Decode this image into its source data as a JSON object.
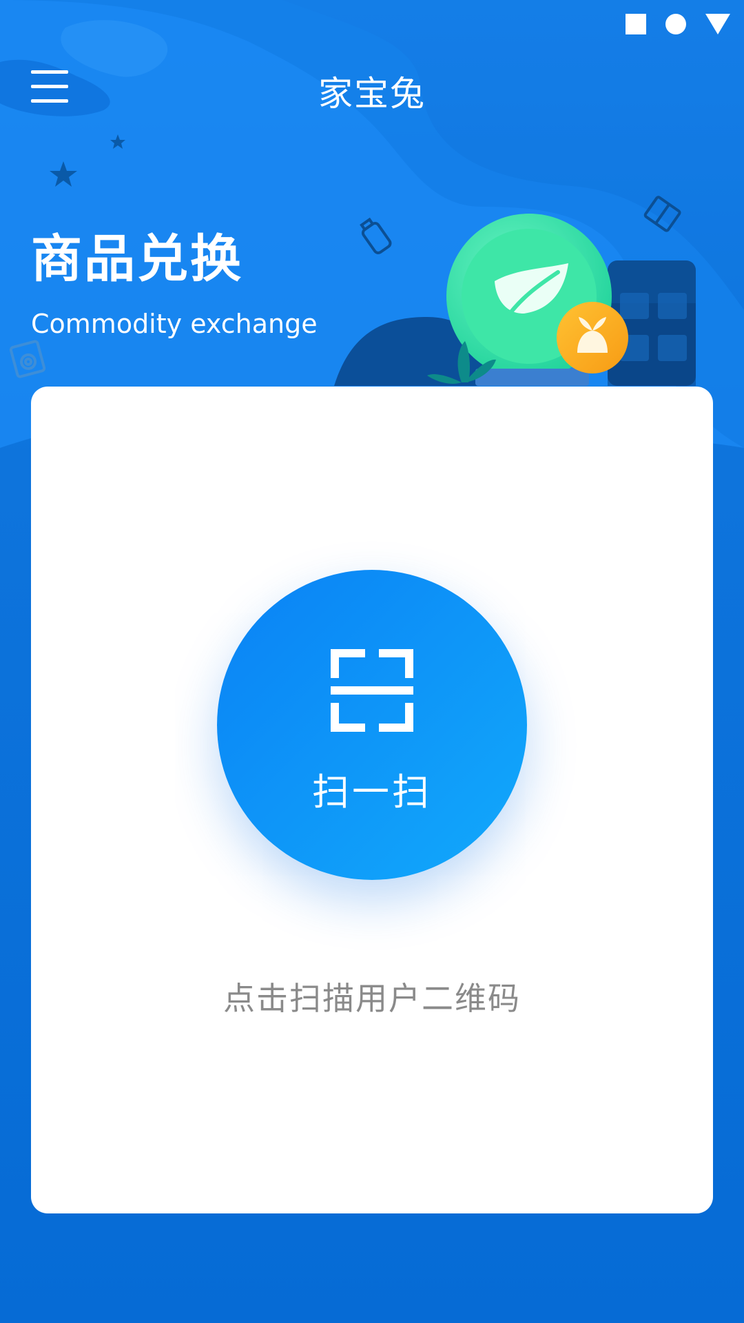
{
  "header": {
    "app_title": "家宝兔",
    "menu_icon": "hamburger-menu-icon"
  },
  "status_bar": {
    "icons": [
      "square-icon",
      "circle-icon",
      "triangle-icon"
    ]
  },
  "hero": {
    "title": "商品兑换",
    "subtitle": "Commodity exchange"
  },
  "scan": {
    "label": "扫一扫",
    "icon": "scan-qr-icon",
    "hint": "点击扫描用户二维码"
  },
  "colors": {
    "primary": "#0a6fd6",
    "accent": "#1aa8fb",
    "coin_green": "#3ee6a0",
    "coin_orange": "#f7a21c",
    "hint_gray": "#8a8a8a"
  }
}
